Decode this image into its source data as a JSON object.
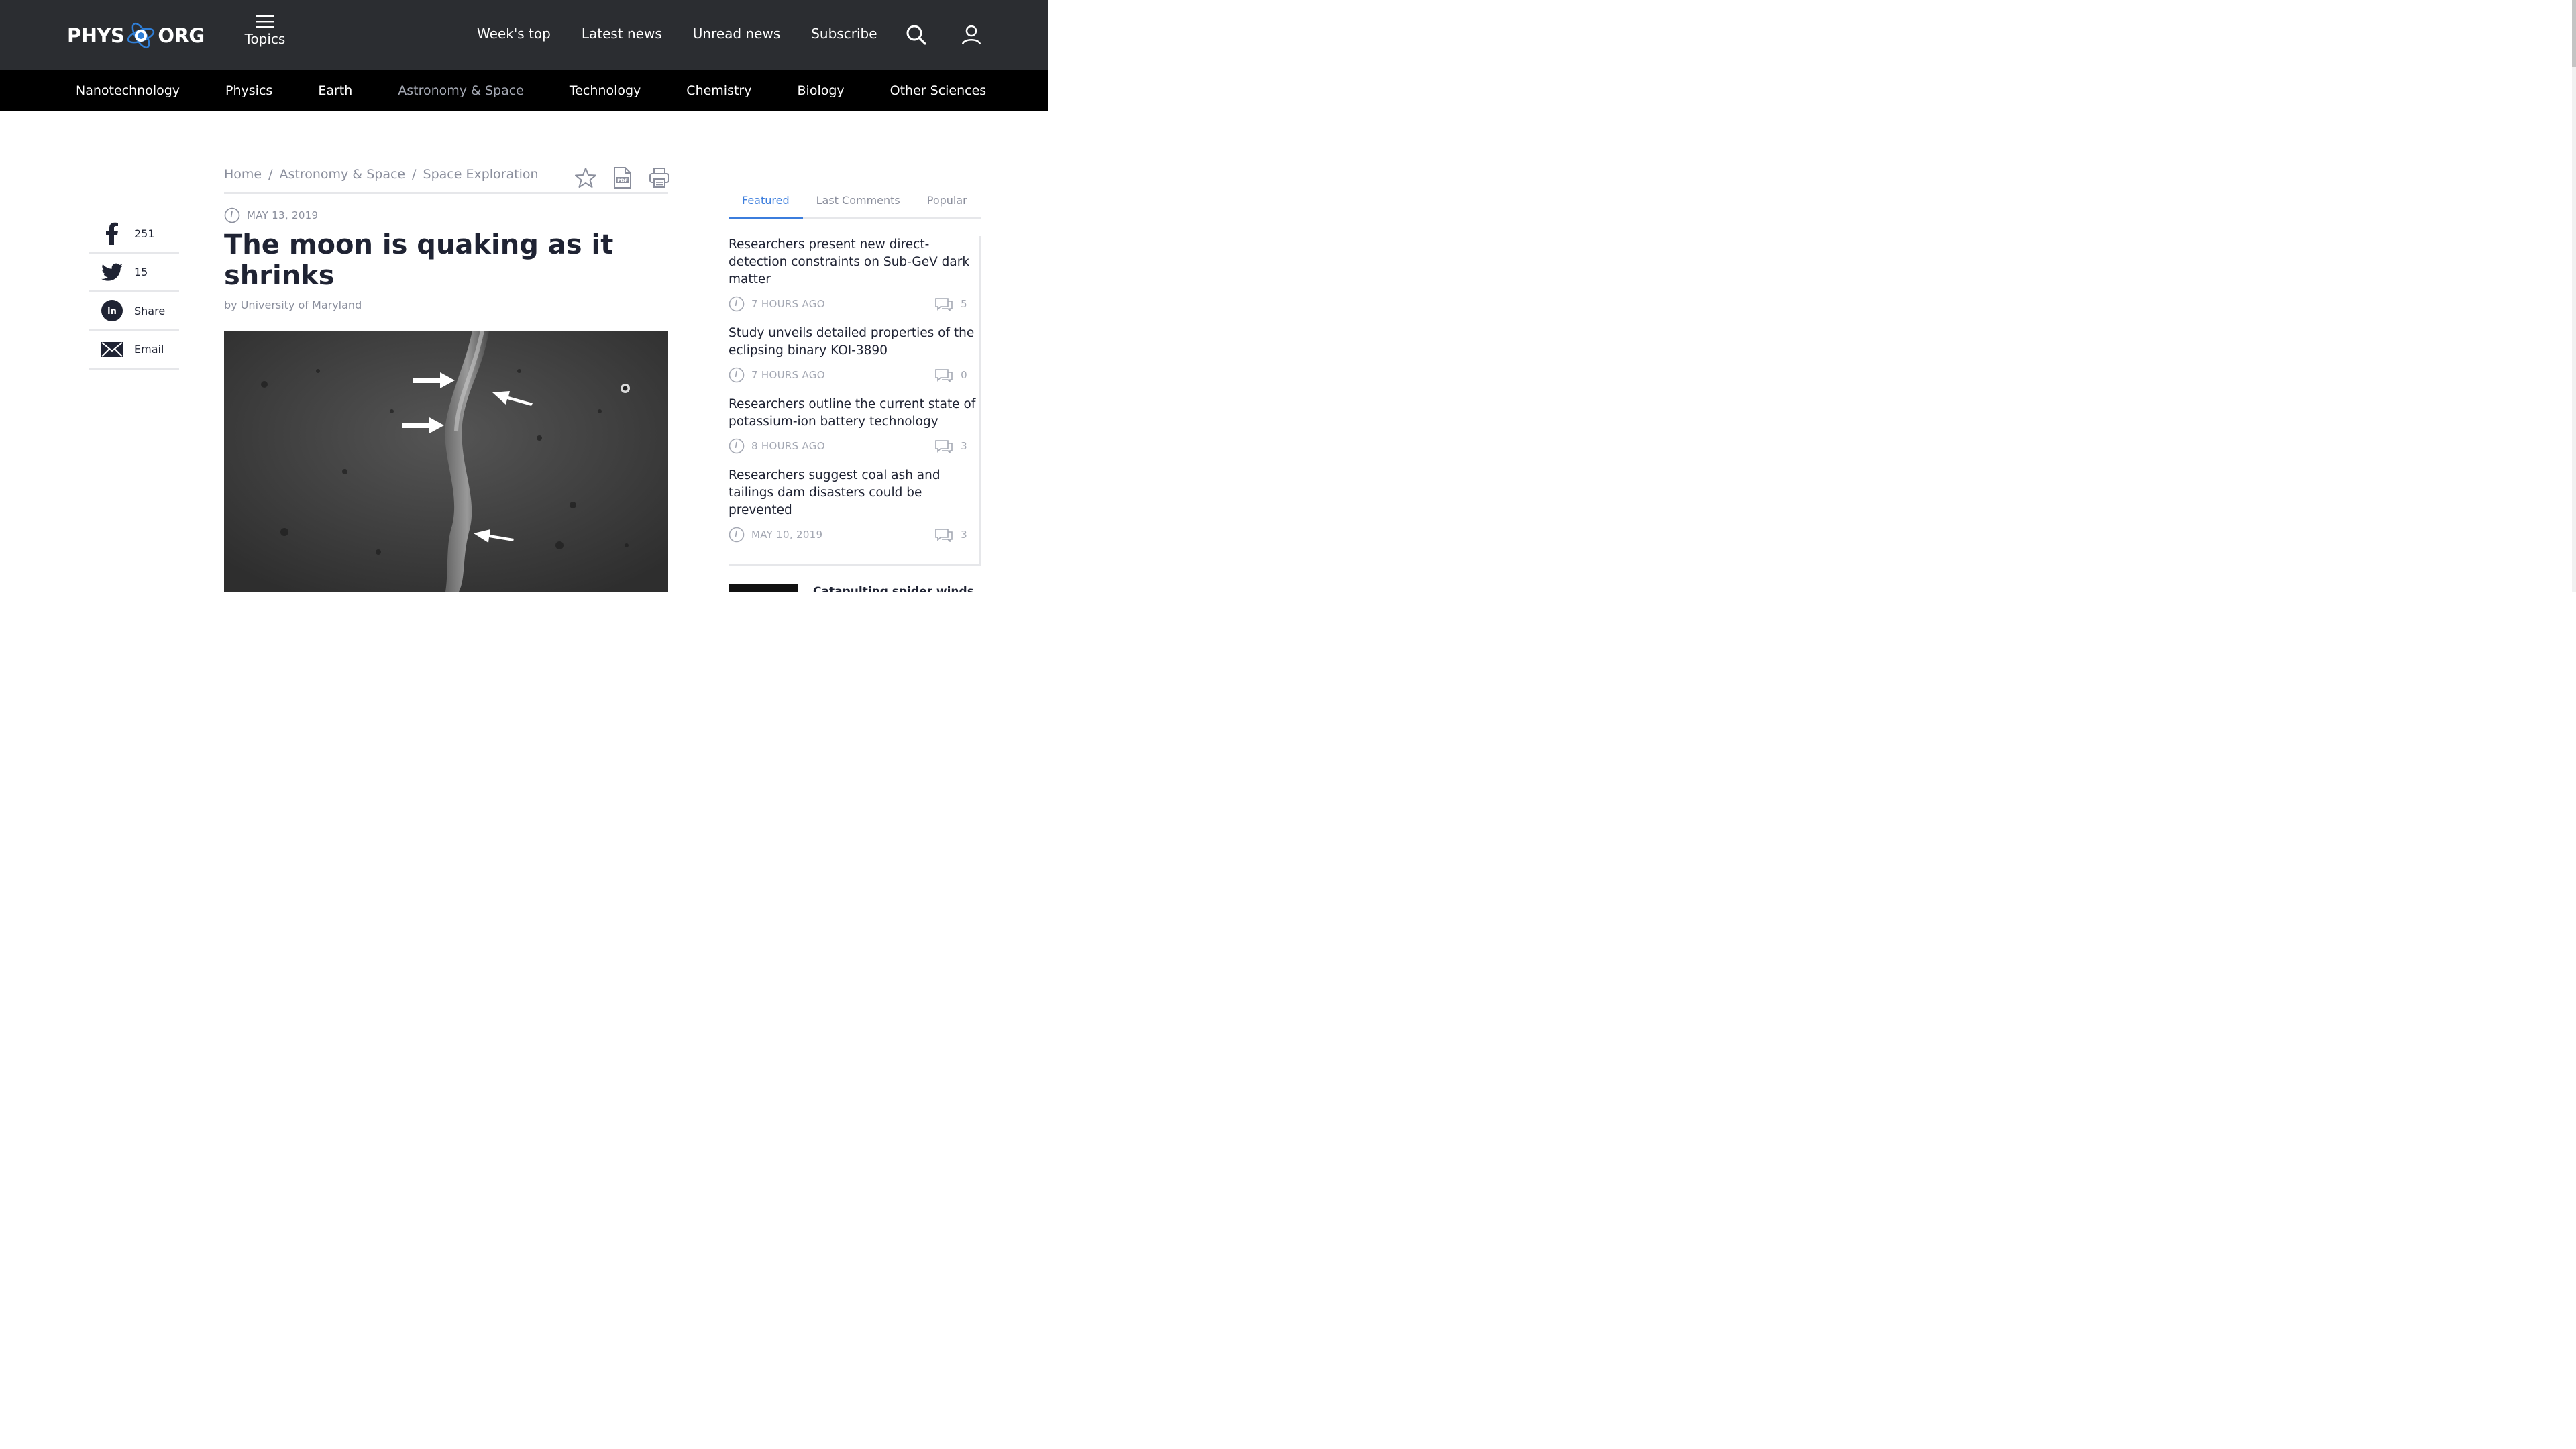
{
  "header": {
    "logo_left": "PHYS",
    "logo_right": "ORG",
    "topics_label": "Topics",
    "nav": [
      "Week's top",
      "Latest news",
      "Unread news",
      "Subscribe"
    ]
  },
  "categories": {
    "items": [
      "Nanotechnology",
      "Physics",
      "Earth",
      "Astronomy & Space",
      "Technology",
      "Chemistry",
      "Biology",
      "Other Sciences"
    ],
    "active": "Astronomy & Space"
  },
  "breadcrumb": {
    "items": [
      "Home",
      "Astronomy & Space",
      "Space Exploration"
    ],
    "separator": "/"
  },
  "share": {
    "facebook_count": "251",
    "twitter_count": "15",
    "linkedin_label": "Share",
    "email_label": "Email"
  },
  "article": {
    "date": "MAY 13, 2019",
    "title": "The moon is quaking as it shrinks",
    "byline": "by University of Maryland"
  },
  "sidebar": {
    "tabs": [
      "Featured",
      "Last Comments",
      "Popular"
    ],
    "active_tab": "Featured",
    "items": [
      {
        "title": "Researchers present new direct-detection constraints on Sub-GeV dark matter",
        "time": "7 HOURS AGO",
        "comments": "5"
      },
      {
        "title": "Study unveils detailed properties of the eclipsing binary KOI-3890",
        "time": "7 HOURS AGO",
        "comments": "0"
      },
      {
        "title": "Researchers outline the current state of potassium-ion battery technology",
        "time": "8 HOURS AGO",
        "comments": "3"
      },
      {
        "title": "Researchers suggest coal ash and tailings dam disasters could be prevented",
        "time": "MAY 10, 2019",
        "comments": "3"
      }
    ],
    "next_title": "Catapulting spider winds up"
  },
  "colors": {
    "header_bg": "#2b2d31",
    "category_bg": "#000000",
    "accent": "#3b7ddd",
    "text": "#1f2333",
    "muted": "#8a8e9c"
  }
}
